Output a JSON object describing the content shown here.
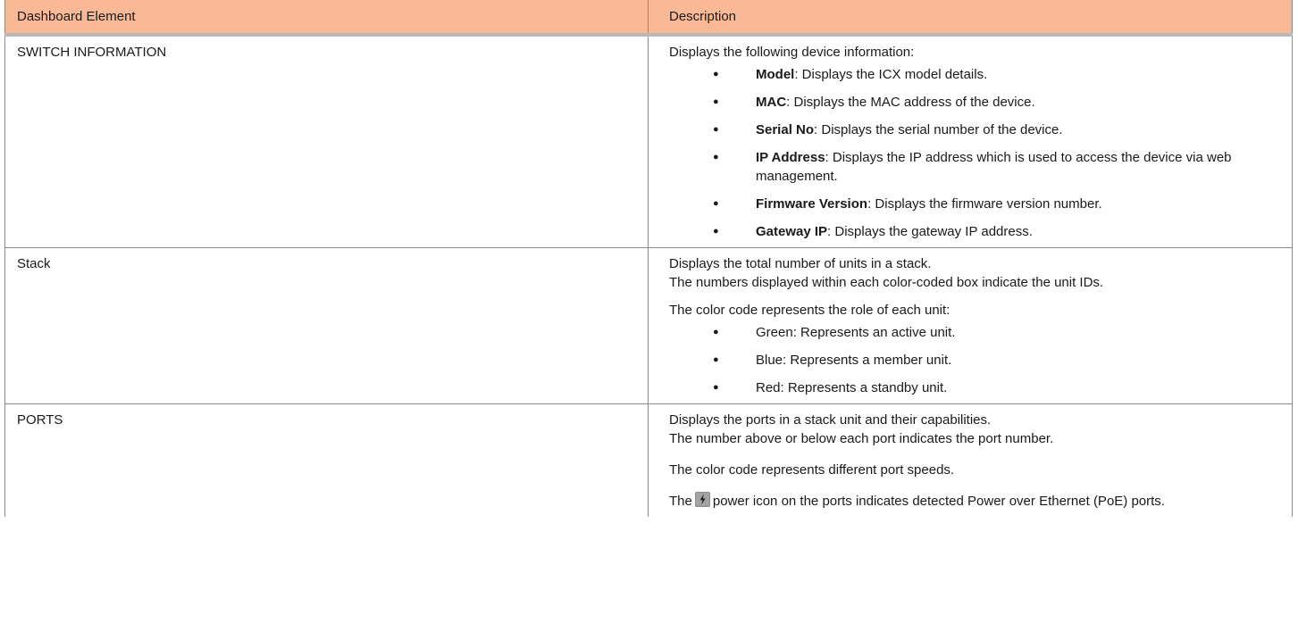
{
  "headers": {
    "col1": "Dashboard Element",
    "col2": "Description"
  },
  "rows": [
    {
      "element": "SWITCH INFORMATION",
      "intro": "Displays the following device information:",
      "bullets": [
        {
          "term": "Model",
          "text": ": Displays the ICX model details."
        },
        {
          "term": "MAC",
          "text": ": Displays the MAC address of the device."
        },
        {
          "term": "Serial No",
          "text": ": Displays the serial number of the device."
        },
        {
          "term": "IP Address",
          "text": ": Displays the IP address which is used to access the device via web management."
        },
        {
          "term": "Firmware Version",
          "text": ": Displays the firmware version number."
        },
        {
          "term": "Gateway IP",
          "text": ": Displays the gateway IP address."
        }
      ]
    },
    {
      "element": "Stack",
      "line1": "Displays the total number of units in a stack.",
      "line2": "The numbers displayed within each color-coded box indicate the unit IDs.",
      "para2": "The color code represents the role of each unit:",
      "bullets": [
        {
          "text": "Green: Represents an active unit."
        },
        {
          "text": "Blue: Represents a member unit."
        },
        {
          "text": "Red: Represents a standby unit."
        }
      ]
    },
    {
      "element": "PORTS",
      "line1": "Displays the ports in a stack unit and their capabilities.",
      "line2": "The number above or below each port indicates the port number.",
      "para2": "The color code represents different port speeds.",
      "para3_before": "The",
      "para3_after": "power icon on the ports indicates detected Power over Ethernet (PoE) ports.",
      "icon": "power-icon"
    }
  ],
  "colors": {
    "header_bg": "#f9b996",
    "border": "#8a8a8a"
  }
}
